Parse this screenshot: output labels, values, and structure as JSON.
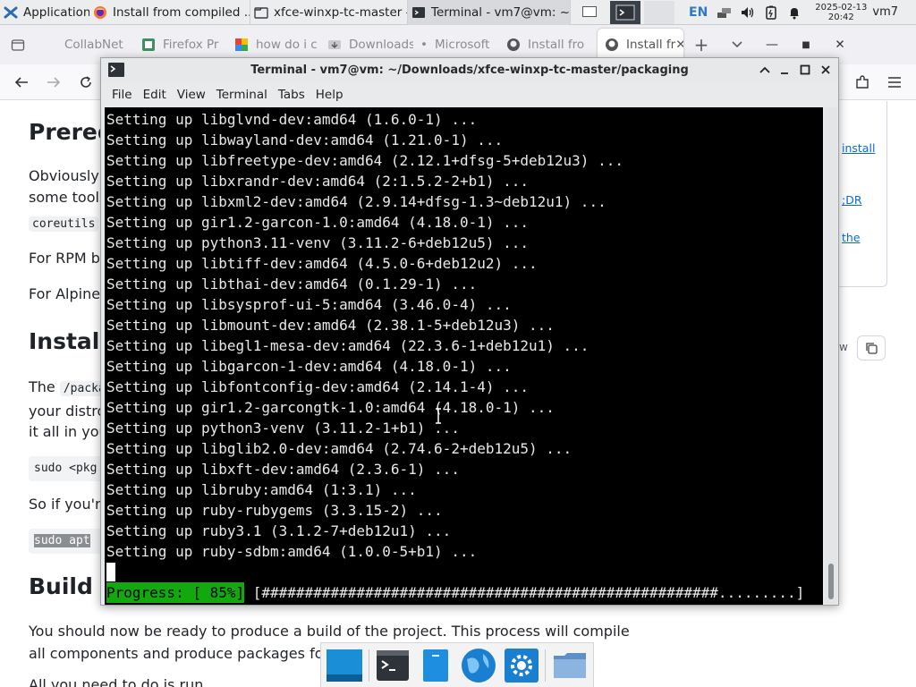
{
  "top_panel": {
    "applications_label": "Applications",
    "tasks": [
      {
        "label": "Install from compiled ...",
        "icon": "firefox-icon"
      },
      {
        "label": "xfce-winxp-tc-master -...",
        "icon": "folder-icon"
      },
      {
        "label": "Terminal - vm7@vm: ~...",
        "icon": "terminal-icon"
      }
    ],
    "language": "EN",
    "clock_date": "2025-02-13",
    "clock_time": "20:42",
    "user": "vm7"
  },
  "firefox": {
    "tabs": [
      {
        "label": "CollabNet",
        "icon": "collabnet-icon"
      },
      {
        "label": "Firefox Pr",
        "icon": "firefox-profile-icon"
      },
      {
        "label": "how do i c",
        "icon": "google-icon"
      },
      {
        "label": "Downloads",
        "icon": "download-icon"
      },
      {
        "label": "Microsoft",
        "icon": "microsoft-icon"
      },
      {
        "label": "Install fro",
        "icon": "github-icon"
      },
      {
        "label": "Install fr",
        "icon": "github-icon"
      }
    ],
    "page": {
      "h_prereq": "Prereq",
      "p_obviously": "Obviously",
      "p_sometools": "some tools",
      "code_coreutils": "coreutils",
      "p_rpm": "For RPM ba",
      "p_alpine": "For Alpine",
      "h_installing": "Installi",
      "p_the": "The",
      "code_packa": "/packa",
      "p_distro": "your distro",
      "p_allin": "it all in you",
      "code_sudo_pkg": "sudo <pkg",
      "p_soifyoure": "So if you're",
      "code_sudo_apt": "sudo apt",
      "h_build": "Build tl",
      "p_ready": "You should now be ready to produce a build of the project. This process will compile",
      "p_components": "all components and produce packages for y",
      "p_allyou": "All you need to do is run",
      "side_link_1": "install",
      "side_link_2": ";DR",
      "side_link_3": "the",
      "raw_label": "w"
    }
  },
  "terminal": {
    "title": "Terminal - vm7@vm: ~/Downloads/xfce-winxp-tc-master/packaging",
    "menu": [
      "File",
      "Edit",
      "View",
      "Terminal",
      "Tabs",
      "Help"
    ],
    "lines": [
      "Setting up libglvnd-dev:amd64 (1.6.0-1) ...",
      "Setting up libwayland-dev:amd64 (1.21.0-1) ...",
      "Setting up libfreetype-dev:amd64 (2.12.1+dfsg-5+deb12u3) ...",
      "Setting up libxrandr-dev:amd64 (2:1.5.2-2+b1) ...",
      "Setting up libxml2-dev:amd64 (2.9.14+dfsg-1.3~deb12u1) ...",
      "Setting up gir1.2-garcon-1.0:amd64 (4.18.0-1) ...",
      "Setting up python3.11-venv (3.11.2-6+deb12u5) ...",
      "Setting up libtiff-dev:amd64 (4.5.0-6+deb12u2) ...",
      "Setting up libthai-dev:amd64 (0.1.29-1) ...",
      "Setting up libsysprof-ui-5:amd64 (3.46.0-4) ...",
      "Setting up libmount-dev:amd64 (2.38.1-5+deb12u3) ...",
      "Setting up libegl1-mesa-dev:amd64 (22.3.6-1+deb12u1) ...",
      "Setting up libgarcon-1-dev:amd64 (4.18.0-1) ...",
      "Setting up libfontconfig-dev:amd64 (2.14.1-4) ...",
      "Setting up gir1.2-garcongtk-1.0:amd64 (4.18.0-1) ...",
      "Setting up python3-venv (3.11.2-1+b1) ...",
      "Setting up libglib2.0-dev:amd64 (2.74.6-2+deb12u5) ...",
      "Setting up libxft-dev:amd64 (2.3.6-1) ...",
      "Setting up libruby:amd64 (1:3.1) ...",
      "Setting up ruby-rubygems (3.3.15-2) ...",
      "Setting up ruby3.1 (3.1.2-7+deb12u1) ...",
      "Setting up ruby-sdbm:amd64 (1.0.0-5+b1) ..."
    ],
    "progress_label": "Progress: [ 85%]",
    "progress_bar": " [#####################################################.........]",
    "progress_percent": 85,
    "progress_color": "#12a90f"
  },
  "dock": {
    "items": [
      "show-desktop-icon",
      "terminal-icon",
      "file-manager-icon",
      "web-browser-icon",
      "settings-icon",
      "folder-icon"
    ]
  }
}
